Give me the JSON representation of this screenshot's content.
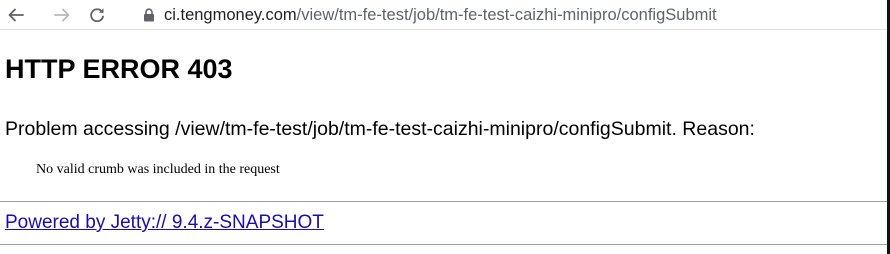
{
  "browser": {
    "url_host": "ci.tengmoney.com",
    "url_path": "/view/tm-fe-test/job/tm-fe-test-caizhi-minipro/configSubmit",
    "icons": {
      "back": "arrow-left-icon",
      "forward": "arrow-right-icon",
      "reload": "reload-icon",
      "security": "lock-icon"
    }
  },
  "error_page": {
    "title": "HTTP ERROR 403",
    "problem_text": "Problem accessing /view/tm-fe-test/job/tm-fe-test-caizhi-minipro/configSubmit. Reason:",
    "reason_message": "No valid crumb was included in the request",
    "footer_link": "Powered by Jetty:// 9.4.z-SNAPSHOT",
    "link_color": "#1a0dab"
  }
}
